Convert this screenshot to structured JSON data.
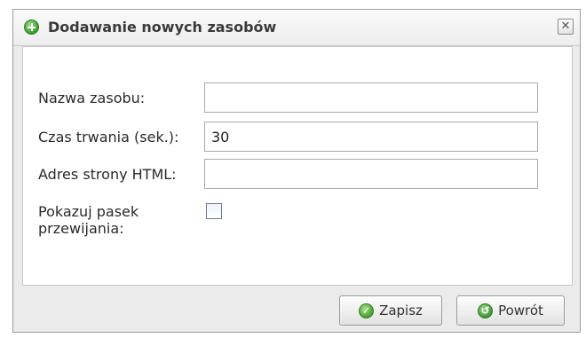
{
  "dialog": {
    "title": "Dodawanie nowych zasobów",
    "close_glyph": "✕",
    "title_icon": "add-circle-icon"
  },
  "form": {
    "name_label": "Nazwa zasobu:",
    "name_value": "",
    "duration_label": "Czas trwania (sek.):",
    "duration_value": "30",
    "url_label": "Adres strony HTML:",
    "url_value": "",
    "scrollbar_label_line1": "Pokazuj pasek",
    "scrollbar_label_line2": "przewijania:",
    "scrollbar_checked": false
  },
  "buttons": {
    "save_label": "Zapisz",
    "save_icon": "checkmark-icon",
    "back_label": "Powrót",
    "back_icon": "back-arrow-icon"
  },
  "colors": {
    "accent_green": "#3a9a2c"
  }
}
